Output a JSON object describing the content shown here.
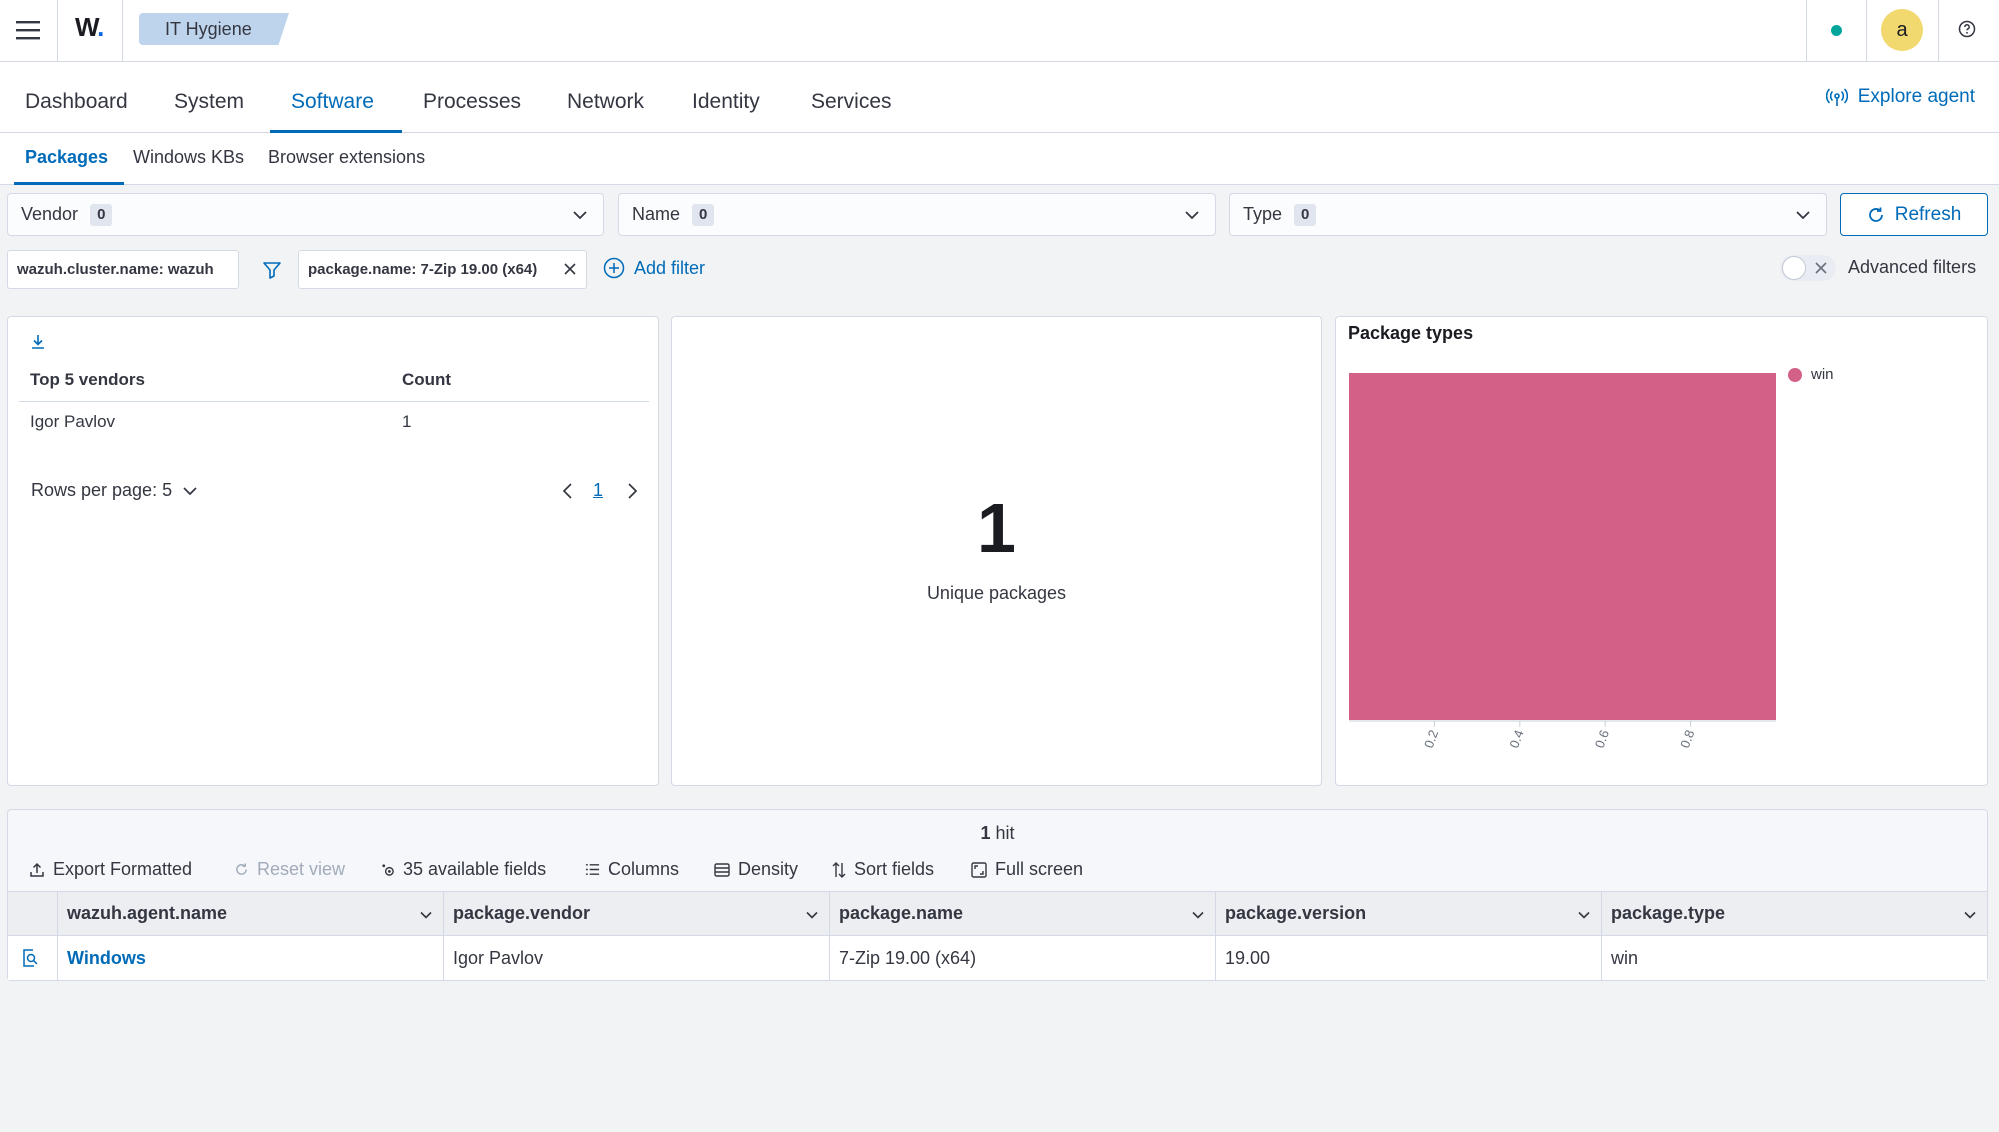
{
  "header": {
    "logo_text": "W",
    "logo_dot": ".",
    "app_name": "IT Hygiene",
    "avatar_letter": "a",
    "status_color": "#00a69b"
  },
  "tabs": [
    {
      "label": "Dashboard"
    },
    {
      "label": "System"
    },
    {
      "label": "Software"
    },
    {
      "label": "Processes"
    },
    {
      "label": "Network"
    },
    {
      "label": "Identity"
    },
    {
      "label": "Services"
    }
  ],
  "explore_agent": "Explore agent",
  "subtabs": [
    {
      "label": "Packages"
    },
    {
      "label": "Windows KBs"
    },
    {
      "label": "Browser extensions"
    }
  ],
  "selects": [
    {
      "label": "Vendor",
      "count": "0"
    },
    {
      "label": "Name",
      "count": "0"
    },
    {
      "label": "Type",
      "count": "0"
    }
  ],
  "refresh_label": "Refresh",
  "filters": {
    "cluster_pill": "wazuh.cluster.name: wazuh",
    "package_pill": "package.name: 7-Zip 19.00 (x64)",
    "add_filter": "Add filter",
    "advanced": "Advanced filters"
  },
  "vendors_table": {
    "headers": [
      "Top 5 vendors",
      "Count"
    ],
    "rows": [
      [
        "Igor Pavlov",
        "1"
      ]
    ],
    "rows_per_page": "Rows per page: 5",
    "page": "1"
  },
  "metric": {
    "value": "1",
    "label": "Unique packages"
  },
  "chart_data": {
    "type": "bar",
    "title": "Package types",
    "orientation": "horizontal",
    "categories": [
      "win"
    ],
    "values": [
      1
    ],
    "xlim": [
      0,
      1
    ],
    "x_ticks": [
      "0.2",
      "0.4",
      "0.6",
      "0.8"
    ],
    "legend": [
      "win"
    ],
    "legend_position": "top-right",
    "series_color": "#d36086"
  },
  "results": {
    "hits_count": "1",
    "hits_word": "hit",
    "toolbar": {
      "export": "Export Formatted",
      "reset": "Reset view",
      "fields": "35 available fields",
      "columns": "Columns",
      "density": "Density",
      "sort": "Sort fields",
      "fullscreen": "Full screen"
    },
    "columns": [
      "wazuh.agent.name",
      "package.vendor",
      "package.name",
      "package.version",
      "package.type"
    ],
    "rows": [
      [
        "Windows",
        "Igor Pavlov",
        "7-Zip 19.00 (x64)",
        "19.00",
        "win"
      ]
    ]
  }
}
